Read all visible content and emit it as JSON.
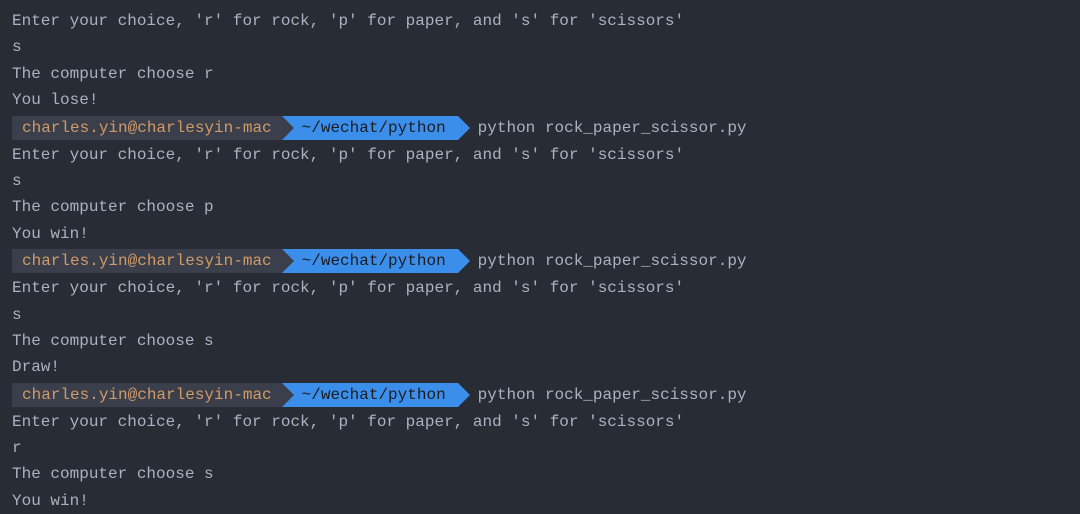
{
  "prompt": {
    "user": "charles.yin@charlesyin-mac",
    "path": "~/wechat/python",
    "command": "python rock_paper_scissor.py"
  },
  "strings": {
    "enter_prompt": "Enter your choice, 'r' for rock, 'p' for paper, and 's' for 'scissors'",
    "computer_prefix": "The computer choose ",
    "lose": "You lose!",
    "win": "You win!",
    "draw": "Draw!"
  },
  "runs": [
    {
      "show_prompt_before": false,
      "user_input": "s",
      "computer_choice": "r",
      "result_key": "lose"
    },
    {
      "show_prompt_before": true,
      "user_input": "s",
      "computer_choice": "p",
      "result_key": "win"
    },
    {
      "show_prompt_before": true,
      "user_input": "s",
      "computer_choice": "s",
      "result_key": "draw"
    },
    {
      "show_prompt_before": true,
      "user_input": "r",
      "computer_choice": "s",
      "result_key": "win"
    }
  ]
}
